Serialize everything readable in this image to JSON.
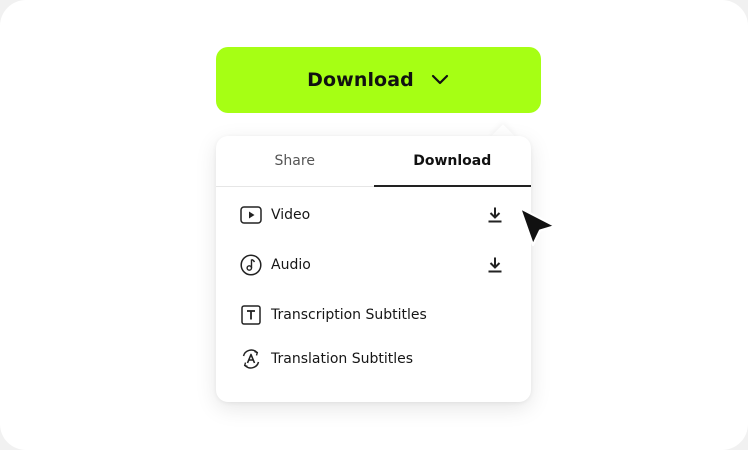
{
  "download_button": {
    "label": "Download",
    "color": "#a6ff14"
  },
  "tabs": [
    {
      "label": "Share",
      "active": false
    },
    {
      "label": "Download",
      "active": true
    }
  ],
  "items": [
    {
      "label": "Video",
      "icon": "video-play-icon",
      "has_download": true
    },
    {
      "label": "Audio",
      "icon": "music-note-icon",
      "has_download": true
    },
    {
      "label": "Transcription Subtitles",
      "icon": "text-t-icon",
      "has_download": false
    },
    {
      "label": "Translation Subtitles",
      "icon": "translate-a-icon",
      "has_download": false
    }
  ],
  "cursor_icon": "mouse-pointer-icon"
}
